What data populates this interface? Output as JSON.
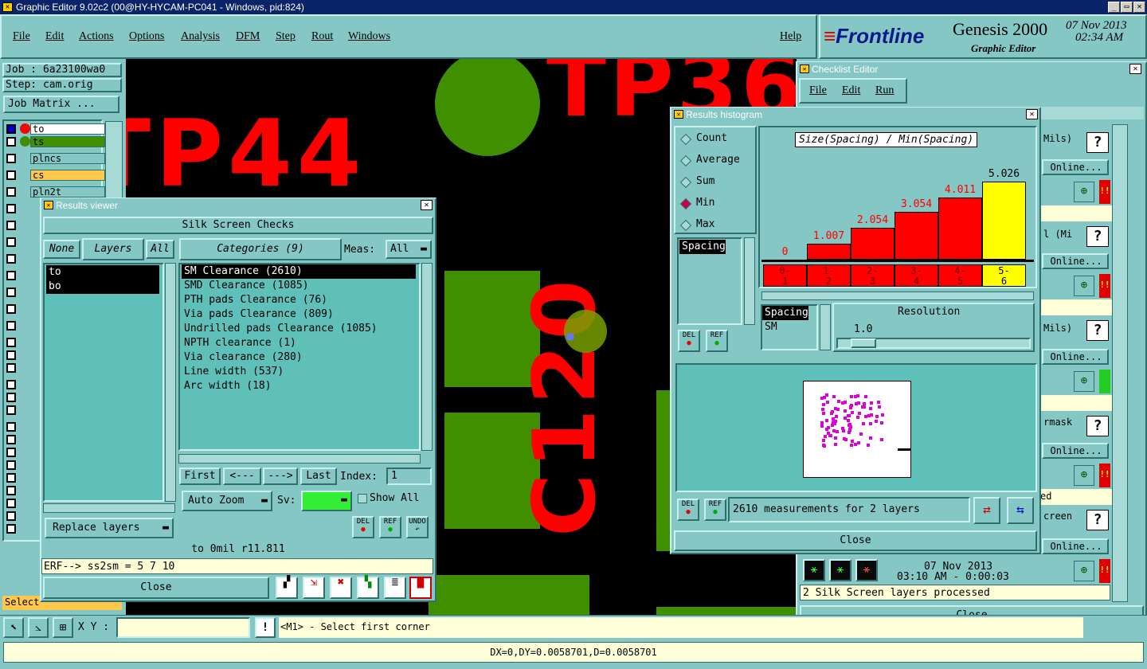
{
  "window": {
    "title": "Graphic Editor 9.02c2 (00@HY-HYCAM-PC041 - Windows, pid:824)"
  },
  "menu": {
    "file": "File",
    "edit": "Edit",
    "actions": "Actions",
    "options": "Options",
    "analysis": "Analysis",
    "dfm": "DFM",
    "step": "Step",
    "rout": "Rout",
    "windows": "Windows",
    "help": "Help"
  },
  "brand": {
    "name": "Frontline",
    "product": "Genesis 2000",
    "sub": "Graphic Editor",
    "date": "07 Nov 2013",
    "time": "02:34 AM"
  },
  "job": {
    "job": "Job : 6a23100wa0",
    "step": "Step: cam.orig",
    "matrix": "Job Matrix ..."
  },
  "layers": [
    {
      "name": "to",
      "color": "#ffffff"
    },
    {
      "name": "ts",
      "color": "#3f8f00"
    },
    {
      "name": "plncs",
      "color": "#84c7c4"
    },
    {
      "name": "cs",
      "color": "#ffc84a"
    },
    {
      "name": "pln2t",
      "color": "#84c7c4"
    }
  ],
  "select_label": "Select",
  "canvas_text": {
    "tp44": "TP44",
    "tp36": "TP36",
    "c120": "C120"
  },
  "results_viewer": {
    "title": "Results viewer",
    "heading": "Silk Screen Checks",
    "none": "None",
    "layers": "Layers",
    "all": "All",
    "categories": "Categories (9)",
    "meas_label": "Meas:",
    "meas_value": "All",
    "layer_list": [
      "to",
      "bo"
    ],
    "category_list": [
      "SM Clearance (2610)",
      "SMD Clearance (1085)",
      "PTH pads Clearance (76)",
      "Via pads Clearance (809)",
      "Undrilled pads Clearance (1085)",
      "NPTH clearance (1)",
      "Via clearance (280)",
      "Line width (537)",
      "Arc width (18)"
    ],
    "first": "First",
    "prev": "<---",
    "next": "--->",
    "last": "Last",
    "index_label": "Index:",
    "index_value": "1",
    "auto_zoom": "Auto Zoom",
    "sv_label": "Sv:",
    "show_all": "Show All",
    "replace_layers": "Replace layers",
    "del": "DEL",
    "ref": "REF",
    "undo": "UNDO",
    "status": "to  0mil  r11.811",
    "erf": "ERF--> ss2sm = 5 7 10",
    "close": "Close"
  },
  "histogram": {
    "title": "Results histogram",
    "radios": [
      "Count",
      "Average",
      "Sum",
      "Min",
      "Max"
    ],
    "selected_radio": "Min",
    "chart_title": "Size(Spacing) / Min(Spacing)",
    "list_item": "Spacing",
    "del": "DEL",
    "ref": "REF",
    "filter_items": [
      "Spacing",
      "SM"
    ],
    "resolution_label": "Resolution",
    "resolution_value": "1.0",
    "measurements": "2610 measurements for 2 layers",
    "close": "Close",
    "chart_data": {
      "type": "bar",
      "categories": [
        "0-1",
        "1-2",
        "2-3",
        "3-4",
        "4-5",
        "5-6"
      ],
      "values": [
        0,
        1.007,
        2.054,
        3.054,
        4.011,
        5.026
      ],
      "value_labels": [
        "0",
        "1.007",
        "2.054",
        "3.054",
        "4.011",
        "5.026"
      ],
      "highlight_index": 5,
      "colors": {
        "bar": "#ff0000",
        "highlight": "#ffff00"
      }
    }
  },
  "checklist": {
    "title": "Checklist Editor",
    "file": "File",
    "edit": "Edit",
    "run": "Run",
    "items": [
      "Mils)",
      "Online...",
      "l (Mi",
      "Online...",
      "Mils)",
      "Online...",
      "rmask",
      "Online...",
      "ed",
      "creen",
      "Online..."
    ],
    "date": "07 Nov 2013",
    "time": "03:10 AM - 0:00:03",
    "status": "2 Silk Screen layers processed",
    "close": "Close"
  },
  "bottom": {
    "xy_label": "X Y :",
    "xy_value": "",
    "prompt": "<M1> - Select first corner",
    "coords": "DX=0,DY=0.0058701,D=0.0058701"
  }
}
